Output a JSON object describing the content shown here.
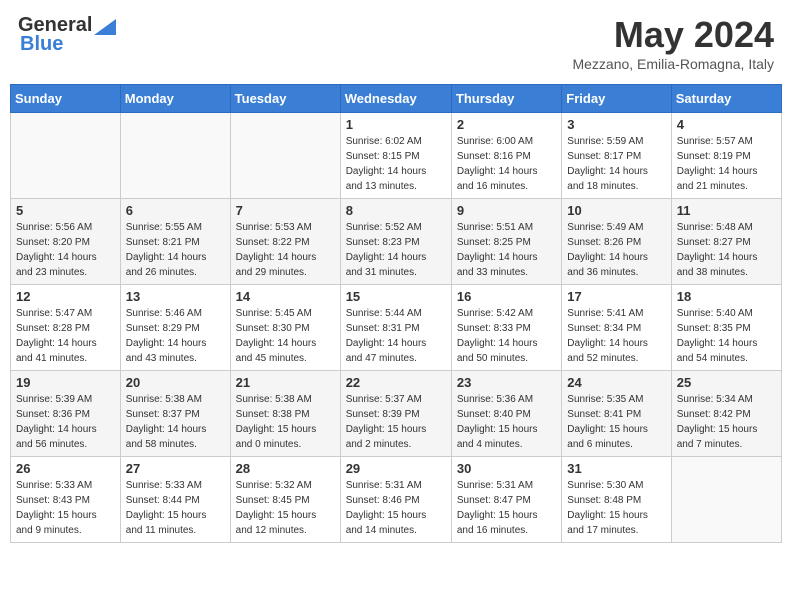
{
  "header": {
    "logo_line1": "General",
    "logo_line2": "Blue",
    "month_title": "May 2024",
    "location": "Mezzano, Emilia-Romagna, Italy"
  },
  "days_of_week": [
    "Sunday",
    "Monday",
    "Tuesday",
    "Wednesday",
    "Thursday",
    "Friday",
    "Saturday"
  ],
  "weeks": [
    {
      "days": [
        {
          "number": "",
          "info": ""
        },
        {
          "number": "",
          "info": ""
        },
        {
          "number": "",
          "info": ""
        },
        {
          "number": "1",
          "info": "Sunrise: 6:02 AM\nSunset: 8:15 PM\nDaylight: 14 hours\nand 13 minutes."
        },
        {
          "number": "2",
          "info": "Sunrise: 6:00 AM\nSunset: 8:16 PM\nDaylight: 14 hours\nand 16 minutes."
        },
        {
          "number": "3",
          "info": "Sunrise: 5:59 AM\nSunset: 8:17 PM\nDaylight: 14 hours\nand 18 minutes."
        },
        {
          "number": "4",
          "info": "Sunrise: 5:57 AM\nSunset: 8:19 PM\nDaylight: 14 hours\nand 21 minutes."
        }
      ]
    },
    {
      "days": [
        {
          "number": "5",
          "info": "Sunrise: 5:56 AM\nSunset: 8:20 PM\nDaylight: 14 hours\nand 23 minutes."
        },
        {
          "number": "6",
          "info": "Sunrise: 5:55 AM\nSunset: 8:21 PM\nDaylight: 14 hours\nand 26 minutes."
        },
        {
          "number": "7",
          "info": "Sunrise: 5:53 AM\nSunset: 8:22 PM\nDaylight: 14 hours\nand 29 minutes."
        },
        {
          "number": "8",
          "info": "Sunrise: 5:52 AM\nSunset: 8:23 PM\nDaylight: 14 hours\nand 31 minutes."
        },
        {
          "number": "9",
          "info": "Sunrise: 5:51 AM\nSunset: 8:25 PM\nDaylight: 14 hours\nand 33 minutes."
        },
        {
          "number": "10",
          "info": "Sunrise: 5:49 AM\nSunset: 8:26 PM\nDaylight: 14 hours\nand 36 minutes."
        },
        {
          "number": "11",
          "info": "Sunrise: 5:48 AM\nSunset: 8:27 PM\nDaylight: 14 hours\nand 38 minutes."
        }
      ]
    },
    {
      "days": [
        {
          "number": "12",
          "info": "Sunrise: 5:47 AM\nSunset: 8:28 PM\nDaylight: 14 hours\nand 41 minutes."
        },
        {
          "number": "13",
          "info": "Sunrise: 5:46 AM\nSunset: 8:29 PM\nDaylight: 14 hours\nand 43 minutes."
        },
        {
          "number": "14",
          "info": "Sunrise: 5:45 AM\nSunset: 8:30 PM\nDaylight: 14 hours\nand 45 minutes."
        },
        {
          "number": "15",
          "info": "Sunrise: 5:44 AM\nSunset: 8:31 PM\nDaylight: 14 hours\nand 47 minutes."
        },
        {
          "number": "16",
          "info": "Sunrise: 5:42 AM\nSunset: 8:33 PM\nDaylight: 14 hours\nand 50 minutes."
        },
        {
          "number": "17",
          "info": "Sunrise: 5:41 AM\nSunset: 8:34 PM\nDaylight: 14 hours\nand 52 minutes."
        },
        {
          "number": "18",
          "info": "Sunrise: 5:40 AM\nSunset: 8:35 PM\nDaylight: 14 hours\nand 54 minutes."
        }
      ]
    },
    {
      "days": [
        {
          "number": "19",
          "info": "Sunrise: 5:39 AM\nSunset: 8:36 PM\nDaylight: 14 hours\nand 56 minutes."
        },
        {
          "number": "20",
          "info": "Sunrise: 5:38 AM\nSunset: 8:37 PM\nDaylight: 14 hours\nand 58 minutes."
        },
        {
          "number": "21",
          "info": "Sunrise: 5:38 AM\nSunset: 8:38 PM\nDaylight: 15 hours\nand 0 minutes."
        },
        {
          "number": "22",
          "info": "Sunrise: 5:37 AM\nSunset: 8:39 PM\nDaylight: 15 hours\nand 2 minutes."
        },
        {
          "number": "23",
          "info": "Sunrise: 5:36 AM\nSunset: 8:40 PM\nDaylight: 15 hours\nand 4 minutes."
        },
        {
          "number": "24",
          "info": "Sunrise: 5:35 AM\nSunset: 8:41 PM\nDaylight: 15 hours\nand 6 minutes."
        },
        {
          "number": "25",
          "info": "Sunrise: 5:34 AM\nSunset: 8:42 PM\nDaylight: 15 hours\nand 7 minutes."
        }
      ]
    },
    {
      "days": [
        {
          "number": "26",
          "info": "Sunrise: 5:33 AM\nSunset: 8:43 PM\nDaylight: 15 hours\nand 9 minutes."
        },
        {
          "number": "27",
          "info": "Sunrise: 5:33 AM\nSunset: 8:44 PM\nDaylight: 15 hours\nand 11 minutes."
        },
        {
          "number": "28",
          "info": "Sunrise: 5:32 AM\nSunset: 8:45 PM\nDaylight: 15 hours\nand 12 minutes."
        },
        {
          "number": "29",
          "info": "Sunrise: 5:31 AM\nSunset: 8:46 PM\nDaylight: 15 hours\nand 14 minutes."
        },
        {
          "number": "30",
          "info": "Sunrise: 5:31 AM\nSunset: 8:47 PM\nDaylight: 15 hours\nand 16 minutes."
        },
        {
          "number": "31",
          "info": "Sunrise: 5:30 AM\nSunset: 8:48 PM\nDaylight: 15 hours\nand 17 minutes."
        },
        {
          "number": "",
          "info": ""
        }
      ]
    }
  ]
}
